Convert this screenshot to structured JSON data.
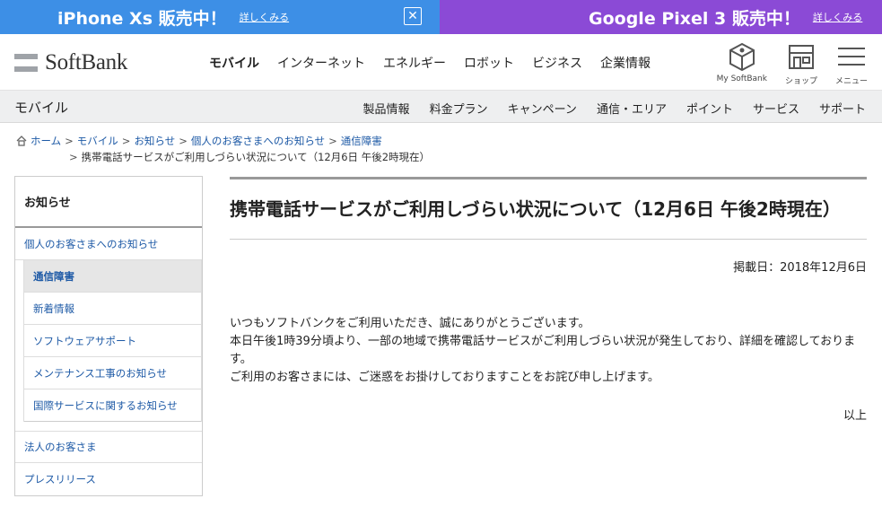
{
  "promo": {
    "left_title": "iPhone Xs 販売中！",
    "left_link": "詳しくみる",
    "right_title": "Google Pixel 3 販売中！",
    "right_link": "詳しくみる",
    "close_symbol": "✕"
  },
  "brand": {
    "name": "SoftBank"
  },
  "global_nav": [
    "モバイル",
    "インターネット",
    "エネルギー",
    "ロボット",
    "ビジネス",
    "企業情報"
  ],
  "header_icons": {
    "mysoftbank": "My SoftBank",
    "shop": "ショップ",
    "menu": "メニュー"
  },
  "subnav": {
    "title": "モバイル",
    "links": [
      "製品情報",
      "料金プラン",
      "キャンペーン",
      "通信・エリア",
      "ポイント",
      "サービス",
      "サポート"
    ]
  },
  "breadcrumb": {
    "items": [
      "ホーム",
      "モバイル",
      "お知らせ",
      "個人のお客さまへのお知らせ",
      "通信障害"
    ],
    "current": "携帯電話サービスがご利用しづらい状況について（12月6日 午後2時現在）"
  },
  "sidebar": {
    "heading": "お知らせ",
    "section": "個人のお客さまへのお知らせ",
    "sub_items": [
      "通信障害",
      "新着情報",
      "ソフトウェアサポート",
      "メンテナンス工事のお知らせ",
      "国際サービスに関するお知らせ"
    ],
    "bottom_items": [
      "法人のお客さま",
      "プレスリリース"
    ]
  },
  "article": {
    "title": "携帯電話サービスがご利用しづらい状況について（12月6日 午後2時現在）",
    "date": "掲載日：2018年12月6日",
    "paragraphs": [
      "いつもソフトバンクをご利用いただき、誠にありがとうございます。",
      "本日午後1時39分頃より、一部の地域で携帯電話サービスがご利用しづらい状況が発生しており、詳細を確認しております。",
      "ご利用のお客さまには、ご迷惑をお掛けしておりますことをお詫び申し上げます。"
    ],
    "closing": "以上"
  }
}
